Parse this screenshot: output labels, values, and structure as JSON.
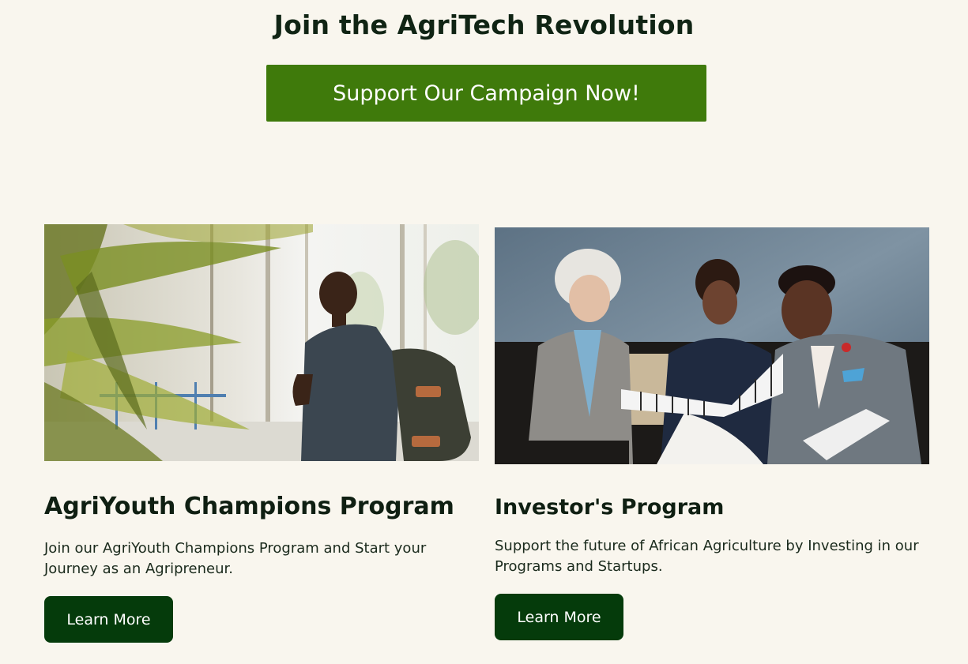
{
  "hero": {
    "title": "Join the AgriTech Revolution",
    "cta_label": "Support Our Campaign Now!"
  },
  "programs": [
    {
      "title": "AgriYouth Champions Program",
      "description": "Join our AgriYouth Champions Program and Start your Journey as an Agripreneur.",
      "button_label": "Learn More"
    },
    {
      "title": "Investor's Program",
      "description": "Support the future of African Agriculture by Investing in our Programs and Startups.",
      "button_label": "Learn More"
    }
  ],
  "colors": {
    "page_background": "#f9f6ee",
    "cta_green": "#3f7a0b",
    "button_dark_green": "#053b0b",
    "heading_text": "#102414"
  }
}
